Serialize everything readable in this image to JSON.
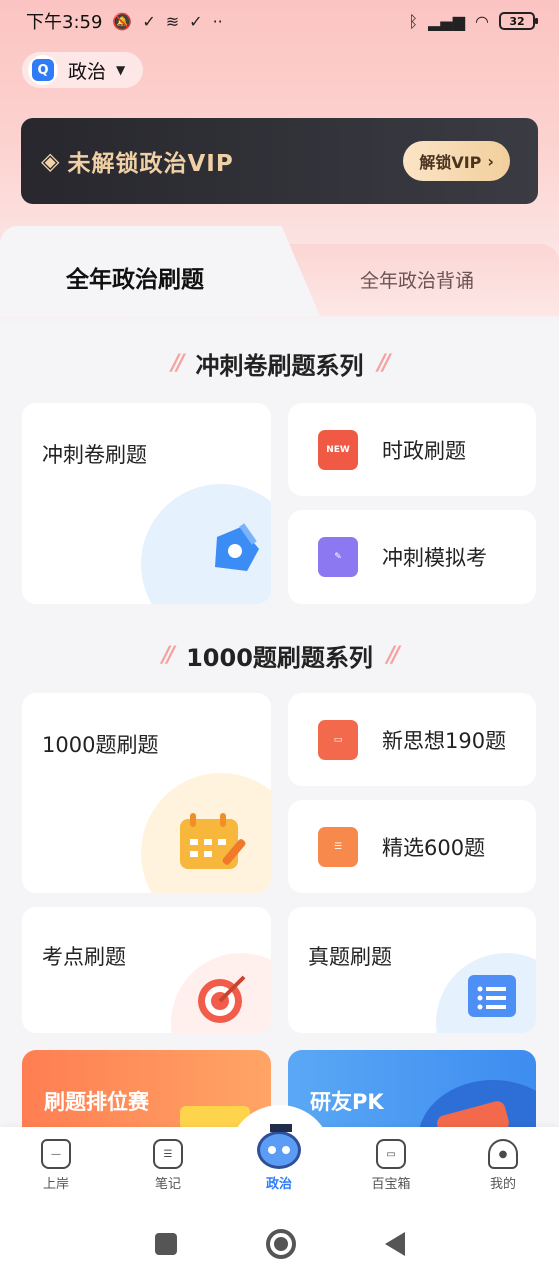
{
  "status_bar": {
    "time": "下午3:59",
    "battery": "32"
  },
  "subject": {
    "logo_icon": "Q",
    "name": "政治"
  },
  "vip_banner": {
    "text": "未解锁政治VIP",
    "button_label": "解锁VIP"
  },
  "tabs": [
    {
      "label": "全年政治刷题",
      "active": true
    },
    {
      "label": "全年政治背诵",
      "active": false
    }
  ],
  "sections": [
    {
      "title": "冲刺卷刷题系列",
      "main_card": {
        "label": "冲刺卷刷题",
        "icon": "pentagon-icon"
      },
      "side_cards": [
        {
          "label": "时政刷题",
          "icon": "news-icon",
          "icon_text": "NEW"
        },
        {
          "label": "冲刺模拟考",
          "icon": "exam-paper-icon"
        }
      ]
    },
    {
      "title": "1000题刷题系列",
      "main_card": {
        "label": "1000题刷题",
        "icon": "calendar-icon"
      },
      "side_cards": [
        {
          "label": "新思想190题",
          "icon": "document-icon"
        },
        {
          "label": "精选600题",
          "icon": "file-list-icon"
        }
      ]
    }
  ],
  "extra_cards": [
    {
      "label": "考点刷题",
      "icon": "target-icon"
    },
    {
      "label": "真题刷题",
      "icon": "folder-list-icon"
    }
  ],
  "promo_cards": [
    {
      "label": "刷题排位赛",
      "color": "#ff8a5b"
    },
    {
      "label": "研友PK",
      "color": "#5aa8f5"
    }
  ],
  "bottom_nav": [
    {
      "label": "上岸",
      "icon": "home-icon"
    },
    {
      "label": "笔记",
      "icon": "notes-icon"
    },
    {
      "label": "政治",
      "icon": "mascot-icon",
      "active": true
    },
    {
      "label": "百宝箱",
      "icon": "toolbox-icon"
    },
    {
      "label": "我的",
      "icon": "profile-icon"
    }
  ],
  "colors": {
    "accent": "#2f7cf6",
    "vip_gold": "#f0d0a4",
    "header_pink": "#fbc4c2"
  }
}
